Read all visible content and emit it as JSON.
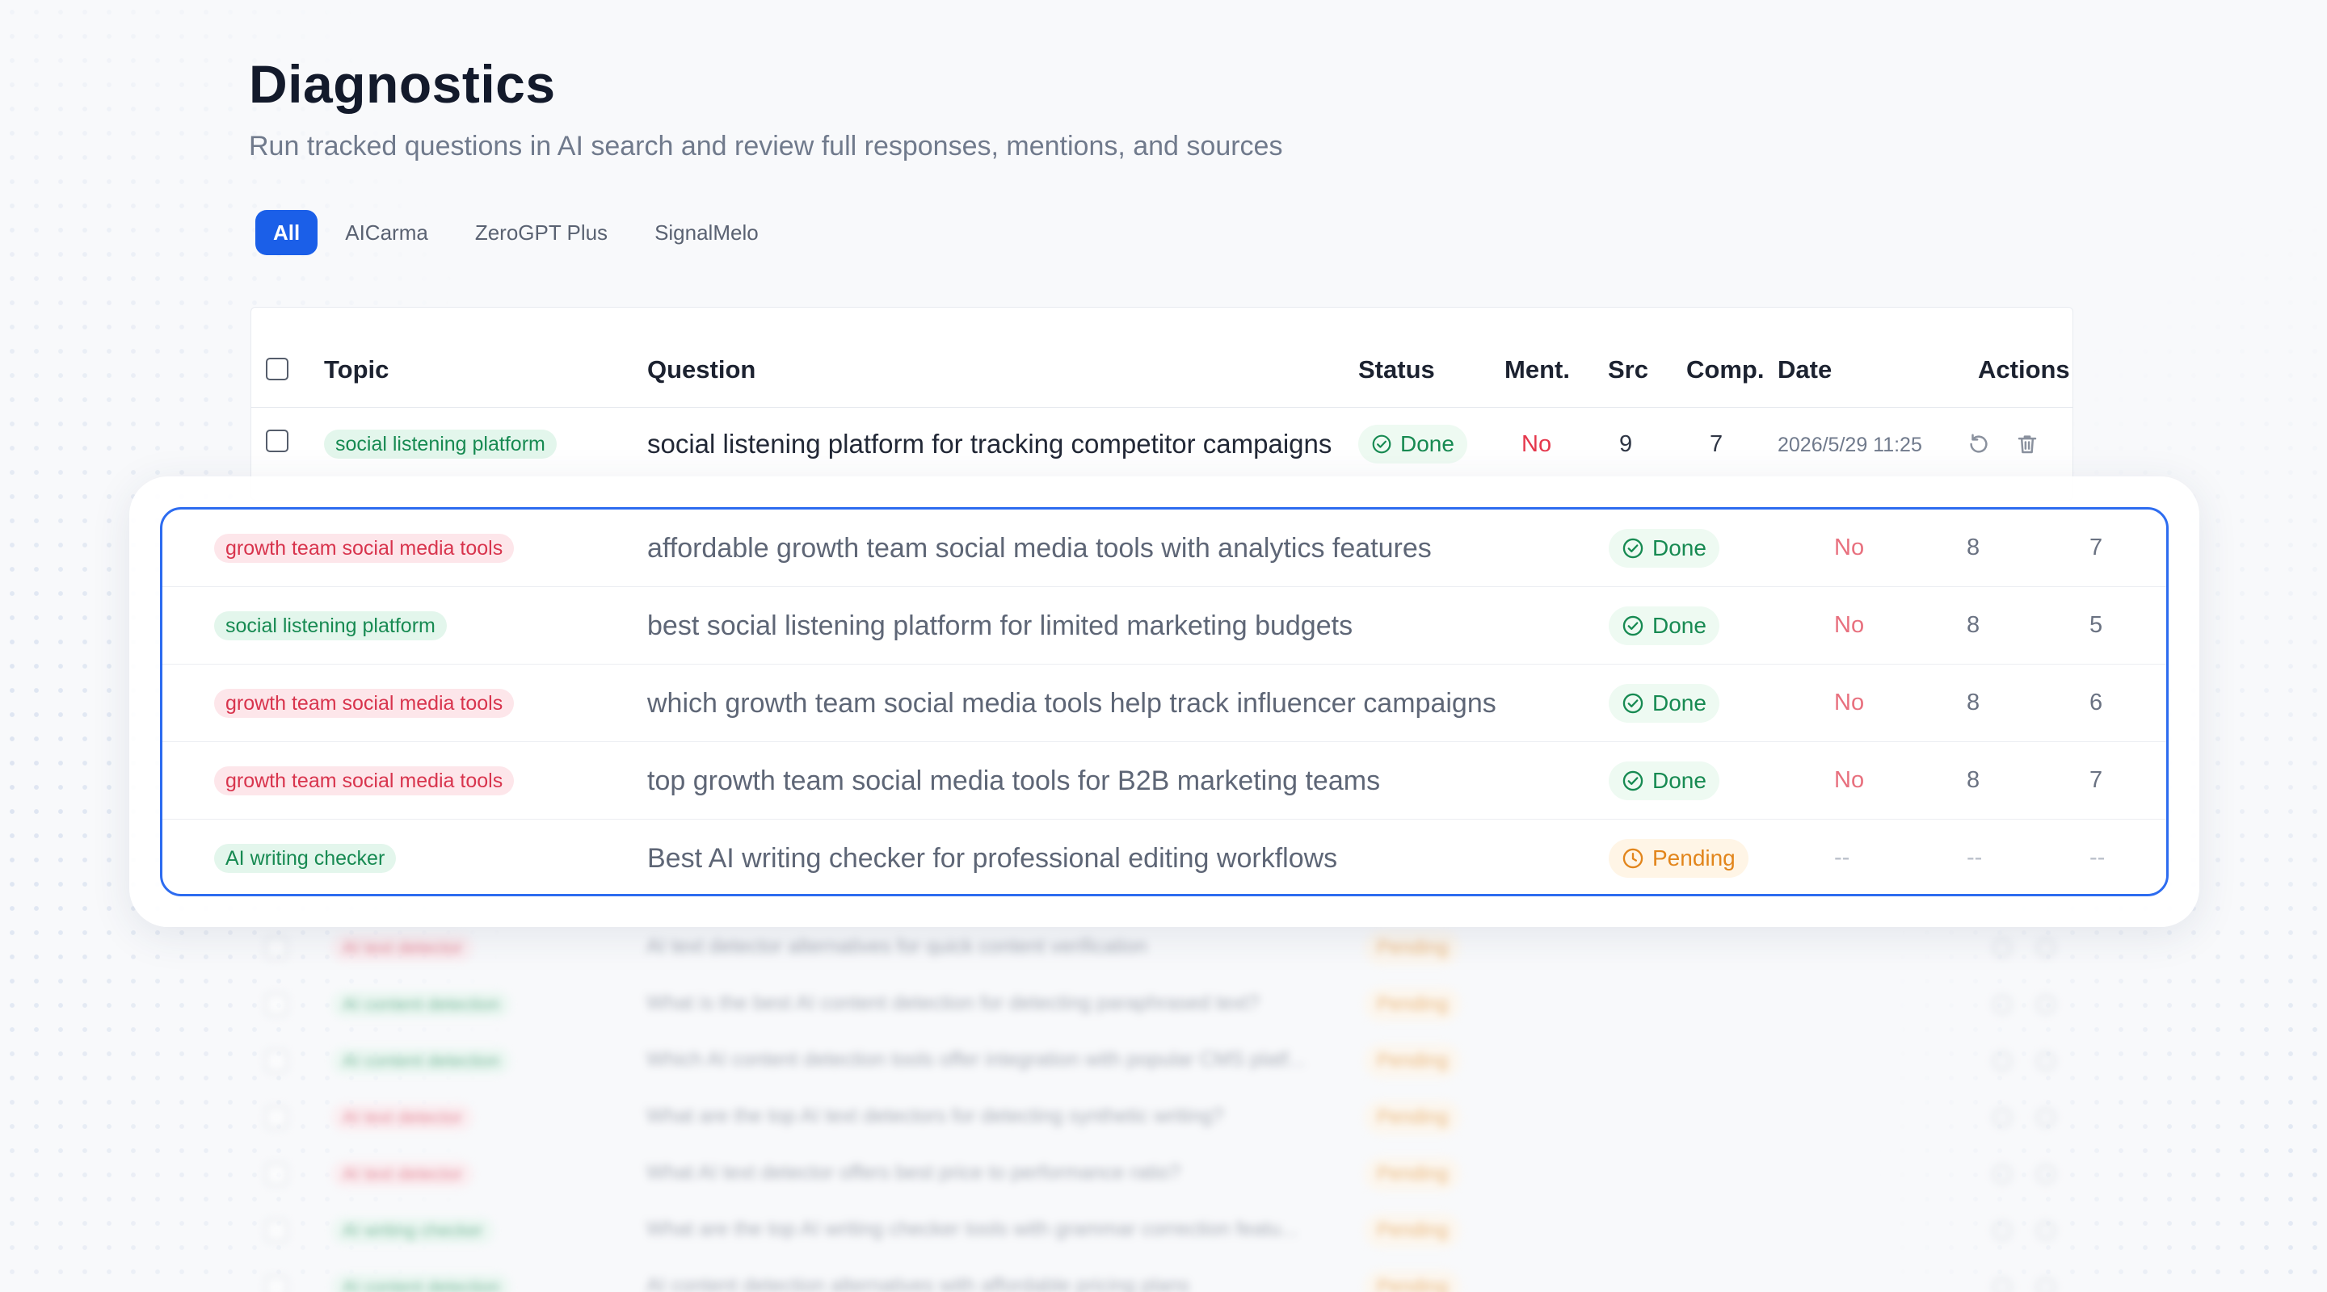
{
  "page": {
    "title": "Diagnostics",
    "subtitle": "Run tracked questions in AI search and review full responses, mentions, and sources"
  },
  "tabs": [
    {
      "label": "All",
      "active": true
    },
    {
      "label": "AICarma",
      "active": false
    },
    {
      "label": "ZeroGPT Plus",
      "active": false
    },
    {
      "label": "SignalMelo",
      "active": false
    }
  ],
  "table": {
    "headers": {
      "topic": "Topic",
      "question": "Question",
      "status": "Status",
      "mentions": "Ment.",
      "sources": "Src",
      "competitors": "Comp.",
      "date": "Date",
      "actions": "Actions"
    },
    "first_row": {
      "topic": "social listening platform",
      "topic_color": "green",
      "question": "social listening platform for tracking competitor campaigns",
      "status": "Done",
      "mentioned": "No",
      "sources": "9",
      "competitors": "7",
      "date": "2026/5/29 11:25"
    },
    "focus_rows": [
      {
        "topic": "growth team social media tools",
        "topic_color": "red",
        "question": "affordable growth team social media tools with analytics features",
        "status": "Done",
        "mentioned": "No",
        "sources": "8",
        "competitors": "7"
      },
      {
        "topic": "social listening platform",
        "topic_color": "green",
        "question": "best social listening platform for limited marketing budgets",
        "status": "Done",
        "mentioned": "No",
        "sources": "8",
        "competitors": "5"
      },
      {
        "topic": "growth team social media tools",
        "topic_color": "red",
        "question": "which growth team social media tools help track influencer campaigns",
        "status": "Done",
        "mentioned": "No",
        "sources": "8",
        "competitors": "6"
      },
      {
        "topic": "growth team social media tools",
        "topic_color": "red",
        "question": "top growth team social media tools for B2B marketing teams",
        "status": "Done",
        "mentioned": "No",
        "sources": "8",
        "competitors": "7"
      },
      {
        "topic": "AI writing checker",
        "topic_color": "green",
        "question": "Best AI writing checker for professional editing workflows",
        "status": "Pending",
        "mentioned": "--",
        "sources": "--",
        "competitors": "--"
      }
    ],
    "blurred_rows": [
      {
        "topic": "AI text detector",
        "topic_color": "red",
        "question": "AI text detector alternatives for quick content verification",
        "status": "Pending"
      },
      {
        "topic": "AI content detection",
        "topic_color": "green",
        "question": "What is the best AI content detection for detecting paraphrased text?",
        "status": "Pending"
      },
      {
        "topic": "AI content detection",
        "topic_color": "green",
        "question": "Which AI content detection tools offer integration with popular CMS platf...",
        "status": "Pending"
      },
      {
        "topic": "AI text detector",
        "topic_color": "red",
        "question": "What are the top AI text detectors for detecting synthetic writing?",
        "status": "Pending"
      },
      {
        "topic": "AI text detector",
        "topic_color": "red",
        "question": "What AI text detector offers best price to performance ratio?",
        "status": "Pending"
      },
      {
        "topic": "AI writing checker",
        "topic_color": "green",
        "question": "What are the top AI writing checker tools with grammar correction featu...",
        "status": "Pending"
      },
      {
        "topic": "AI content detection",
        "topic_color": "green",
        "question": "AI content detection alternatives with affordable pricing plans",
        "status": "Pending"
      }
    ]
  },
  "colors": {
    "accent": "#1b5fe8",
    "focus_border": "#2d6cf0",
    "done": "#178a52",
    "pending": "#e2851b",
    "no": "#e5374c",
    "tag_green_bg": "#e3f6ec",
    "tag_red_bg": "#fde6ea"
  },
  "icons": {
    "done": "check-circle-icon",
    "pending": "clock-icon",
    "rerun": "refresh-icon",
    "delete": "trash-icon"
  }
}
